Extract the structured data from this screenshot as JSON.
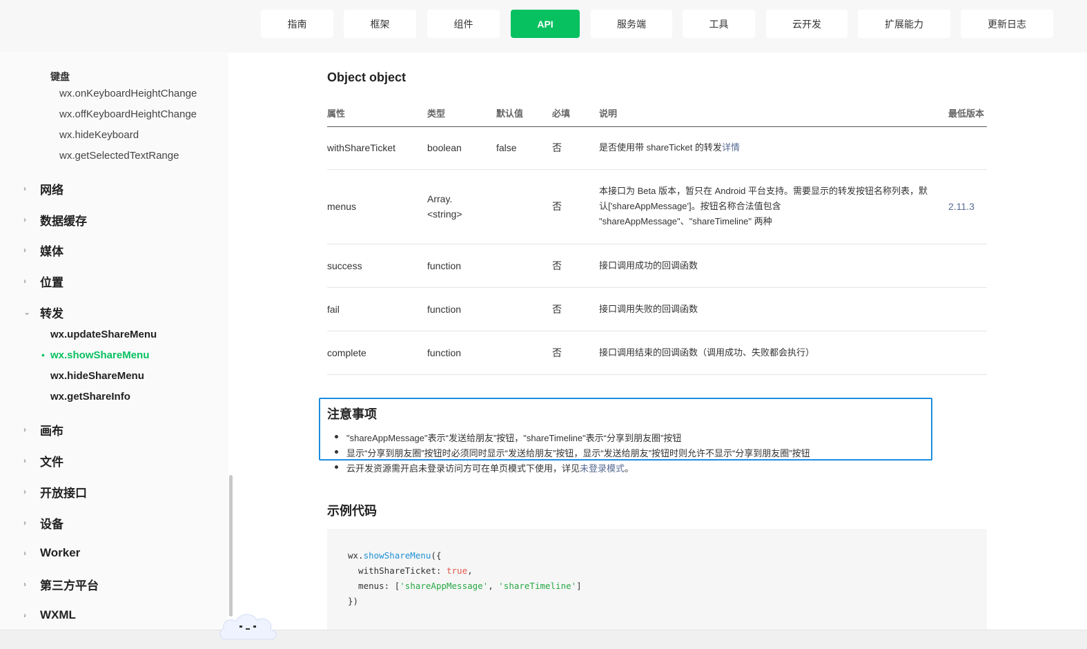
{
  "nav": {
    "items": [
      "指南",
      "框架",
      "组件",
      "API",
      "服务端",
      "工具",
      "云开发",
      "扩展能力",
      "更新日志"
    ],
    "active": "API",
    "accent": "#07c160"
  },
  "sidebar": {
    "group_keyboard": "键盘",
    "keyboard_items": [
      "wx.onKeyboardHeightChange",
      "wx.offKeyboardHeightChange",
      "wx.hideKeyboard",
      "wx.getSelectedTextRange"
    ],
    "categories_top": [
      "网络",
      "数据缓存",
      "媒体",
      "位置"
    ],
    "open_category": "转发",
    "share_items": [
      "wx.updateShareMenu",
      "wx.showShareMenu",
      "wx.hideShareMenu",
      "wx.getShareInfo"
    ],
    "active_item": "wx.showShareMenu",
    "categories_bottom": [
      "画布",
      "文件",
      "开放接口",
      "设备",
      "Worker",
      "第三方平台",
      "WXML"
    ]
  },
  "content": {
    "object_heading": "Object object",
    "table_headers": [
      "属性",
      "类型",
      "默认值",
      "必填",
      "说明",
      "最低版本"
    ],
    "rows": [
      {
        "name": "withShareTicket",
        "type": "boolean",
        "default": "false",
        "required": "否",
        "desc": "是否使用带 shareTicket 的转发",
        "desc_link": "详情",
        "version": ""
      },
      {
        "name": "menus",
        "type": "Array.<string>",
        "default": "",
        "required": "否",
        "desc": "本接口为 Beta 版本，暂只在 Android 平台支持。需要显示的转发按钮名称列表，默认['shareAppMessage']。按钮名称合法值包含 \"shareAppMessage\"、\"shareTimeline\" 两种",
        "desc_link": "",
        "version": "2.11.3"
      },
      {
        "name": "success",
        "type": "function",
        "default": "",
        "required": "否",
        "desc": "接口调用成功的回调函数",
        "desc_link": "",
        "version": ""
      },
      {
        "name": "fail",
        "type": "function",
        "default": "",
        "required": "否",
        "desc": "接口调用失败的回调函数",
        "desc_link": "",
        "version": ""
      },
      {
        "name": "complete",
        "type": "function",
        "default": "",
        "required": "否",
        "desc": "接口调用结束的回调函数（调用成功、失败都会执行）",
        "desc_link": "",
        "version": ""
      }
    ],
    "notice_heading": "注意事项",
    "notice_items": [
      "\"shareAppMessage\"表示“发送给朋友”按钮，\"shareTimeline\"表示“分享到朋友圈”按钮",
      "显示“分享到朋友圈”按钮时必须同时显示“发送给朋友”按钮，显示“发送给朋友”按钮时则允许不显示“分享到朋友圈”按钮"
    ],
    "notice_item3_text": "云开发资源需开启未登录访问方可在单页模式下使用，详见",
    "notice_item3_link": "未登录模式",
    "notice_item3_end": "。",
    "code_heading": "示例代码",
    "code": {
      "l1_obj": "wx.",
      "l1_fn": "showShareMenu",
      "l1_end": "({",
      "l2_key": "  withShareTicket: ",
      "l2_val": "true",
      "l2_end": ",",
      "l3_key": "  menus: [",
      "l3_s1": "'shareAppMessage'",
      "l3_sep": ", ",
      "l3_s2": "'shareTimeline'",
      "l3_end": "]",
      "l4": "})"
    }
  }
}
